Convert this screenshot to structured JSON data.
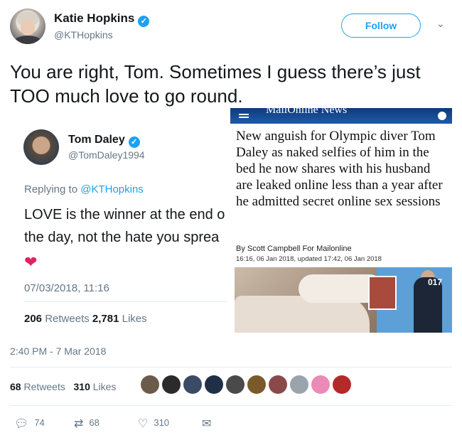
{
  "author": {
    "name": "Katie Hopkins",
    "handle": "@KTHopkins"
  },
  "follow_label": "Follow",
  "tweet_text": "You are right, Tom. Sometimes I guess there’s just TOO much love to go round.",
  "embedded_left": {
    "name": "Tom Daley",
    "handle": "@TomDaley1994",
    "replying_prefix": "Replying to ",
    "replying_to": "@KTHopkins",
    "text_line1": "LOVE is the winner at the end o",
    "text_line2": "the day, not the hate you sprea",
    "heart": "❤",
    "date": "07/03/2018, 11:16",
    "retweets_count": "206",
    "retweets_label": "Retweets",
    "likes_count": "2,781",
    "likes_label": "Likes"
  },
  "embedded_right": {
    "masthead": "MailOnline News",
    "headline": "New anguish for Olympic diver Tom Daley as naked selfies of him in the bed he now shares with his husband are leaked online less than a year after he admitted secret online sex sessions",
    "byline": "By Scott Campbell For Mailonline",
    "dateline": "16:16, 06 Jan 2018, updated 17:42, 06 Jan 2018",
    "photo_label": "017"
  },
  "timestamp": "2:40 PM - 7 Mar 2018",
  "stats": {
    "retweets_count": "68",
    "retweets_label": "Retweets",
    "likes_count": "310",
    "likes_label": "Likes"
  },
  "likers_colors": [
    "#6b5b4a",
    "#2b2b2b",
    "#3b4a66",
    "#1f3046",
    "#4a4a4a",
    "#7a5a2a",
    "#8a4a4a",
    "#9aa4ad",
    "#e98bb6",
    "#b32a2a"
  ],
  "actions": {
    "reply_count": "74",
    "retweet_count": "68",
    "like_count": "310"
  },
  "colors": {
    "accent": "#1da1f2",
    "muted": "#657786",
    "text": "#14171a",
    "heart": "#e0245e"
  }
}
